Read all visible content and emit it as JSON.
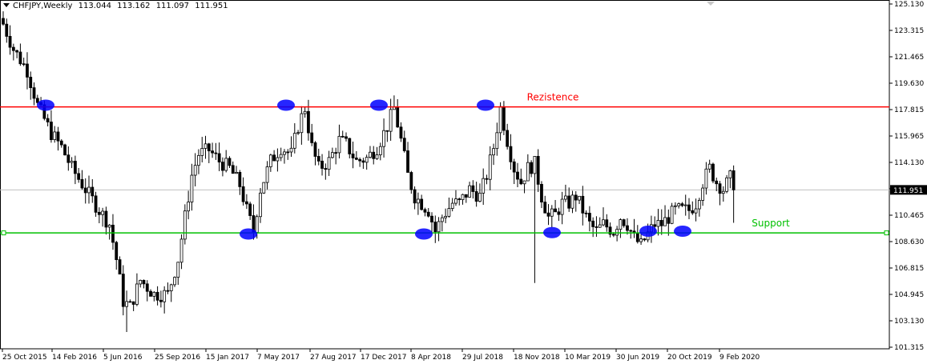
{
  "header": {
    "symbol": "CHFJPY,Weekly",
    "ohlc": [
      "113.044",
      "113.162",
      "111.097",
      "111.951"
    ]
  },
  "colors": {
    "candle": "#000000",
    "resistance": "#ff0000",
    "support": "#00c000",
    "marker": "#0000ff",
    "price_line": "#c0c0c0",
    "axis": "#000000"
  },
  "chart_data": {
    "type": "candlestick",
    "symbol": "CHFJPY",
    "timeframe": "Weekly",
    "ylim": [
      100.6,
      125.4
    ],
    "y_ticks": [
      "125.130",
      "123.315",
      "121.465",
      "119.630",
      "117.815",
      "115.965",
      "114.130",
      "112.315",
      "110.465",
      "108.630",
      "106.815",
      "104.945",
      "103.130",
      "101.315"
    ],
    "x_ticks": [
      "25 Oct 2015",
      "14 Feb 2016",
      "5 Jun 2016",
      "25 Sep 2016",
      "15 Jan 2017",
      "7 May 2017",
      "27 Aug 2017",
      "17 Dec 2017",
      "8 Apr 2018",
      "29 Jul 2018",
      "18 Nov 2018",
      "10 Mar 2019",
      "30 Jun 2019",
      "20 Oct 2019",
      "9 Feb 2020"
    ],
    "current_price": "111.951",
    "levels": [
      {
        "name": "Rezistence",
        "value": 117.88,
        "color": "#ff0000"
      },
      {
        "name": "Support",
        "value": 108.88,
        "color": "#00c000"
      }
    ],
    "touch_markers": [
      {
        "date": "Jan 2016",
        "price": 118.0
      },
      {
        "date": "Mar 2017",
        "price": 108.8
      },
      {
        "date": "May 2017",
        "price": 118.0
      },
      {
        "date": "Dec 2017",
        "price": 118.0
      },
      {
        "date": "Apr 2018",
        "price": 108.8
      },
      {
        "date": "Jul 2018",
        "price": 118.0
      },
      {
        "date": "Dec 2018",
        "price": 108.9
      },
      {
        "date": "Jul 2019",
        "price": 109.0
      },
      {
        "date": "Sep 2019",
        "price": 109.0
      }
    ],
    "close_path": [
      [
        0,
        123.8
      ],
      [
        3,
        122.0
      ],
      [
        7,
        120.5
      ],
      [
        10,
        118.0
      ],
      [
        14,
        116.0
      ],
      [
        17,
        115.0
      ],
      [
        20,
        113.5
      ],
      [
        24,
        112.0
      ],
      [
        28,
        110.5
      ],
      [
        31,
        109.5
      ],
      [
        33,
        107.0
      ],
      [
        35,
        104.0
      ],
      [
        37,
        103.6
      ],
      [
        40,
        105.5
      ],
      [
        44,
        104.5
      ],
      [
        48,
        104.5
      ],
      [
        51,
        107.0
      ],
      [
        53,
        110.0
      ],
      [
        55,
        113.0
      ],
      [
        57,
        114.5
      ],
      [
        60,
        114.8
      ],
      [
        63,
        114.0
      ],
      [
        66,
        113.5
      ],
      [
        69,
        112.3
      ],
      [
        71,
        110.5
      ],
      [
        73,
        109.0
      ],
      [
        75,
        112.0
      ],
      [
        78,
        114.0
      ],
      [
        81,
        115.0
      ],
      [
        84,
        114.5
      ],
      [
        86,
        116.5
      ],
      [
        88,
        117.8
      ],
      [
        90,
        115.0
      ],
      [
        92,
        113.5
      ],
      [
        95,
        114.0
      ],
      [
        98,
        115.5
      ],
      [
        100,
        115.2
      ],
      [
        103,
        114.0
      ],
      [
        106,
        114.2
      ],
      [
        109,
        115.0
      ],
      [
        112,
        116.5
      ],
      [
        114,
        117.8
      ],
      [
        116,
        115.5
      ],
      [
        118,
        113.0
      ],
      [
        120,
        111.5
      ],
      [
        122,
        111.0
      ],
      [
        124,
        110.5
      ],
      [
        126,
        109.0
      ],
      [
        128,
        110.0
      ],
      [
        131,
        111.0
      ],
      [
        133,
        111.0
      ],
      [
        136,
        112.0
      ],
      [
        139,
        111.5
      ],
      [
        141,
        113.0
      ],
      [
        143,
        115.0
      ],
      [
        145,
        117.8
      ],
      [
        147,
        115.5
      ],
      [
        149,
        113.5
      ],
      [
        151,
        112.5
      ],
      [
        153,
        113.5
      ],
      [
        155,
        113.8
      ],
      [
        157,
        111.5
      ],
      [
        159,
        110.0
      ],
      [
        161,
        110.2
      ],
      [
        163,
        111.0
      ],
      [
        165,
        111.0
      ],
      [
        167,
        111.5
      ],
      [
        169,
        110.5
      ],
      [
        171,
        109.5
      ],
      [
        173,
        109.0
      ],
      [
        175,
        109.5
      ],
      [
        178,
        109.0
      ],
      [
        180,
        110.0
      ],
      [
        182,
        109.5
      ],
      [
        184,
        108.5
      ],
      [
        186,
        108.0
      ],
      [
        188,
        108.8
      ],
      [
        190,
        109.5
      ],
      [
        192,
        109.5
      ],
      [
        194,
        110.0
      ],
      [
        196,
        110.5
      ],
      [
        198,
        110.5
      ],
      [
        200,
        110.5
      ],
      [
        202,
        111.0
      ],
      [
        204,
        112.5
      ],
      [
        206,
        113.5
      ],
      [
        208,
        112.5
      ],
      [
        210,
        112.0
      ],
      [
        212,
        112.8
      ],
      [
        213,
        111.951
      ]
    ]
  }
}
